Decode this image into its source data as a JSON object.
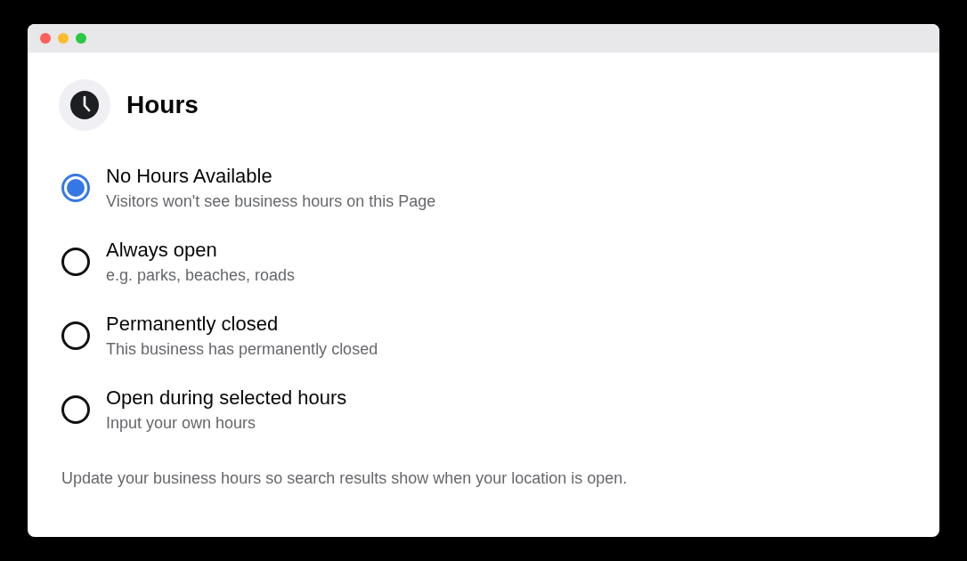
{
  "header": {
    "title": "Hours"
  },
  "options": [
    {
      "label": "No Hours Available",
      "description": "Visitors won't see business hours on this Page",
      "selected": true
    },
    {
      "label": "Always open",
      "description": "e.g. parks, beaches, roads",
      "selected": false
    },
    {
      "label": "Permanently closed",
      "description": "This business has permanently closed",
      "selected": false
    },
    {
      "label": "Open during selected hours",
      "description": "Input your own hours",
      "selected": false
    }
  ],
  "footer": {
    "note": "Update your business hours so search results show when your location is open."
  }
}
